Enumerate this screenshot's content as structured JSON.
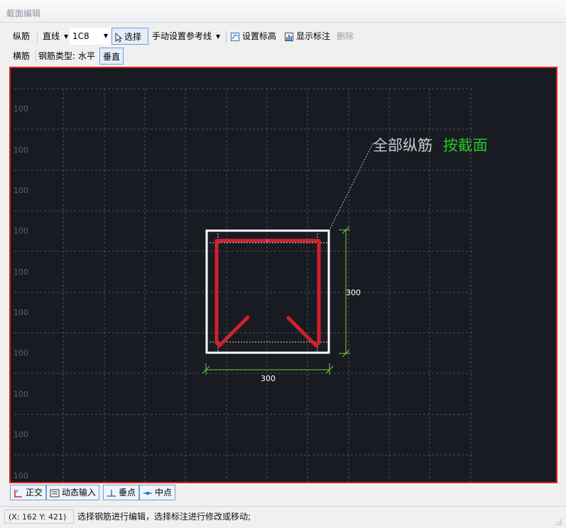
{
  "window": {
    "title": "截面编辑"
  },
  "toolbar1": {
    "longitudinal": "纵筋",
    "line_type": "直线",
    "rebar_spec": "1C8",
    "select": "选择",
    "manual_ref": "手动设置参考线",
    "set_elevation": "设置标高",
    "show_annotation": "显示标注",
    "delete": "删除"
  },
  "toolbar2": {
    "transverse": "横筋",
    "rebar_type_label": "钢筋类型:",
    "horizontal": "水平",
    "vertical": "垂直"
  },
  "canvas": {
    "grid_labels": [
      "100",
      "100",
      "100",
      "100",
      "100",
      "100",
      "100",
      "100",
      "100",
      "100"
    ],
    "annotation_main": "全部纵筋",
    "annotation_mode": "按截面",
    "dim_width": "300",
    "dim_height": "300",
    "colors": {
      "background": "#181b22",
      "rebar": "#d0202c",
      "section": "#ffffff",
      "dimension": "#6fcf3a",
      "annotation_mode": "#27c527"
    }
  },
  "bottombar": {
    "ortho": "正交",
    "dynamic_input": "动态输入",
    "perpendicular": "垂点",
    "midpoint": "中点"
  },
  "status": {
    "coords": "(X: 162 Y: 421)",
    "message": "选择钢筋进行编辑，选择标注进行修改或移动;"
  }
}
